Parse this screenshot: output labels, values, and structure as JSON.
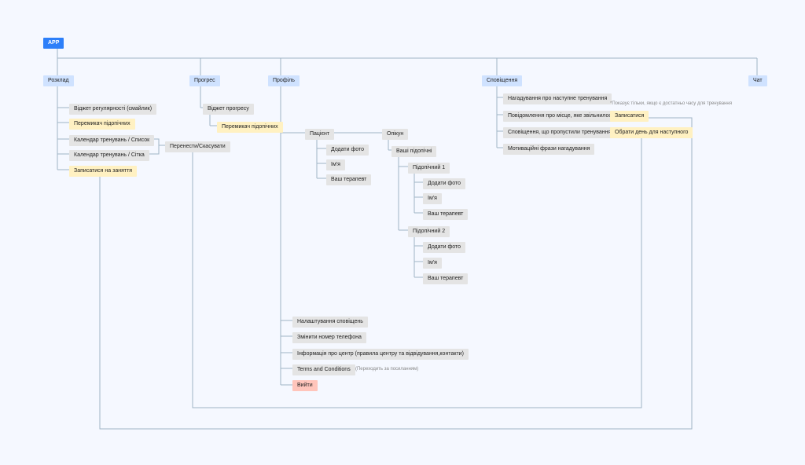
{
  "root": "APP",
  "sections": {
    "schedule": "Розклад",
    "progress": "Прогрес",
    "profile": "Профіль",
    "notifications": "Сповіщення",
    "chat": "Чат"
  },
  "schedule": {
    "widget": "Віджет регулярності (смайлик)",
    "switch": "Перемикач підопічних",
    "calendar_list": "Календар тренувань / Список",
    "calendar_grid": "Календар тренувань / Сітка",
    "signup": "Записатися на заняття",
    "reschedule": "Перенести/Скасувати"
  },
  "progress": {
    "widget": "Віджет прогресу",
    "switch": "Перемикач підопічних"
  },
  "profile": {
    "patient": "Пацієнт",
    "add_photo": "Додати фото",
    "name": "Ім'я",
    "therapist": "Ваш терапевт",
    "guardian": "Опікун",
    "wards": "Ваші підопічні",
    "ward1": "Підопічний 1",
    "ward2": "Підопічний 2",
    "notif_settings": "Налаштування сповіщень",
    "change_phone": "Змінити номер телефона",
    "center_info": "Інформація про центр (правила центру та відвідування,контакти)",
    "terms": "Terms and Conditions",
    "terms_note": "(Переходить за посиланням)",
    "exit": "Вийти"
  },
  "notifications": {
    "next_training": "Нагадування про наступне тренування",
    "freed_slot": "Повідомлення про місце, яке звільнилося",
    "missed": "Сповіщення, що пропустили тренування",
    "motivational": "Мотиваційні фрази нагадування",
    "signup": "Записатися",
    "choose_day": "Обрати день для наступного",
    "note": "*Показує тільки, якщо є достатньо часу для тренування"
  }
}
